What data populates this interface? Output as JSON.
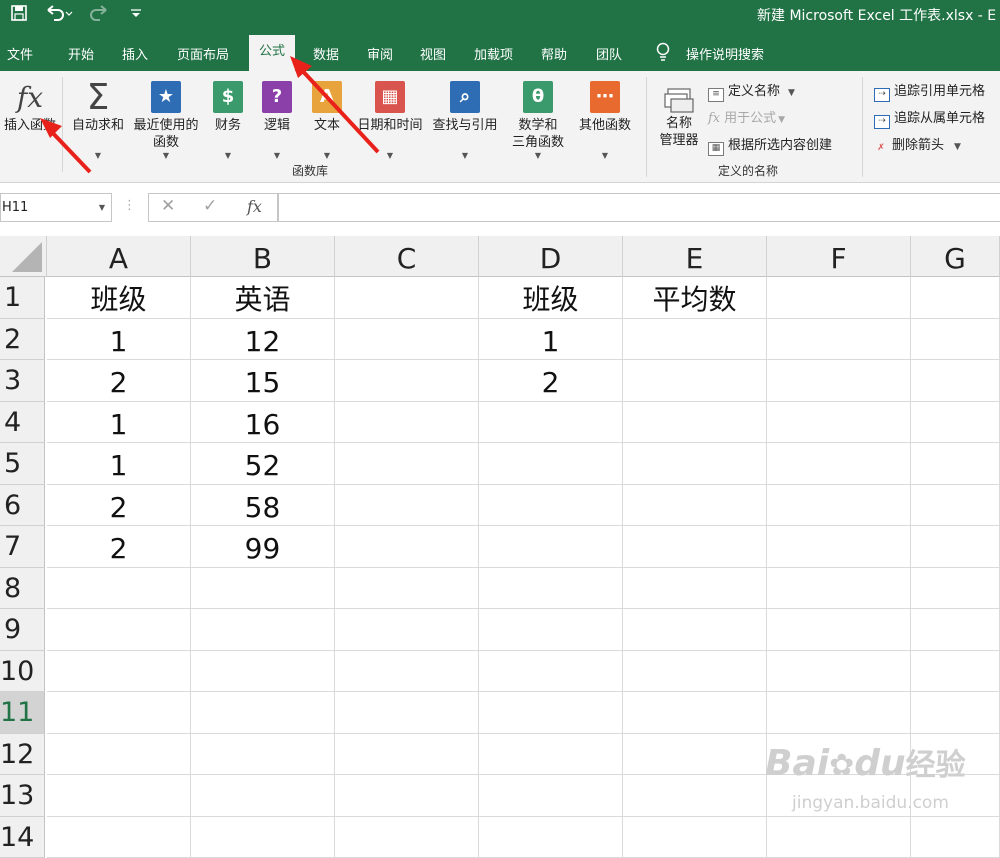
{
  "window": {
    "title": "新建 Microsoft Excel 工作表.xlsx - E",
    "quick_access": {
      "save_icon": "save-icon",
      "undo_icon": "undo-icon",
      "redo_icon": "redo-icon",
      "customize_icon": "customize-qat-icon"
    }
  },
  "ribbon_tabs": [
    "文件",
    "开始",
    "插入",
    "页面布局",
    "公式",
    "数据",
    "审阅",
    "视图",
    "加载项",
    "帮助",
    "团队"
  ],
  "active_tab": "公式",
  "tell_me": "操作说明搜索",
  "ribbon": {
    "insert_function": "插入函数",
    "function_library": {
      "label": "函数库",
      "buttons": [
        {
          "line1": "自动求和",
          "line2": "",
          "icon": "sigma-icon",
          "color": "#444444"
        },
        {
          "line1": "最近使用的",
          "line2": "函数",
          "icon": "star-icon",
          "color": "#2e6db4"
        },
        {
          "line1": "财务",
          "line2": "",
          "icon": "money-icon",
          "color": "#3a9a6b"
        },
        {
          "line1": "逻辑",
          "line2": "",
          "icon": "question-icon",
          "color": "#8b3fa8"
        },
        {
          "line1": "文本",
          "line2": "",
          "icon": "text-icon",
          "color": "#e8a33c"
        },
        {
          "line1": "日期和时间",
          "line2": "",
          "icon": "calendar-icon",
          "color": "#d9534f"
        },
        {
          "line1": "查找与引用",
          "line2": "",
          "icon": "magnify-icon",
          "color": "#2e6db4"
        },
        {
          "line1": "数学和",
          "line2": "三角函数",
          "icon": "theta-icon",
          "color": "#3a9a6b"
        },
        {
          "line1": "其他函数",
          "line2": "",
          "icon": "more-icon",
          "color": "#e86a2e"
        }
      ]
    },
    "defined_names": {
      "label": "定义的名称",
      "name_manager_line1": "名称",
      "name_manager_line2": "管理器",
      "define_name": "定义名称",
      "use_in_formula": "用于公式",
      "create_from_selection": "根据所选内容创建"
    },
    "formula_auditing": {
      "trace_precedents": "追踪引用单元格",
      "trace_dependents": "追踪从属单元格",
      "remove_arrows": "删除箭头"
    }
  },
  "formula_bar": {
    "name_box": "H11",
    "value": "",
    "cancel": "✕",
    "enter": "✓",
    "fx": "fx"
  },
  "columns": [
    "A",
    "B",
    "C",
    "D",
    "E",
    "F",
    "G"
  ],
  "rows": [
    "1",
    "2",
    "3",
    "4",
    "5",
    "6",
    "7",
    "8",
    "9",
    "10",
    "11",
    "12",
    "13",
    "14"
  ],
  "selected_row": "11",
  "cells": {
    "A1": "班级",
    "B1": "英语",
    "D1": "班级",
    "E1": "平均数",
    "A2": "1",
    "B2": "12",
    "D2": "1",
    "A3": "2",
    "B3": "15",
    "D3": "2",
    "A4": "1",
    "B4": "16",
    "A5": "1",
    "B5": "52",
    "A6": "2",
    "B6": "58",
    "A7": "2",
    "B7": "99"
  },
  "watermark": {
    "line1": "Bai",
    "line2": "du",
    "line3": "经验",
    "url": "jingyan.baidu.com"
  },
  "accent_color": "#217346",
  "annotation_color": "#e8221b"
}
